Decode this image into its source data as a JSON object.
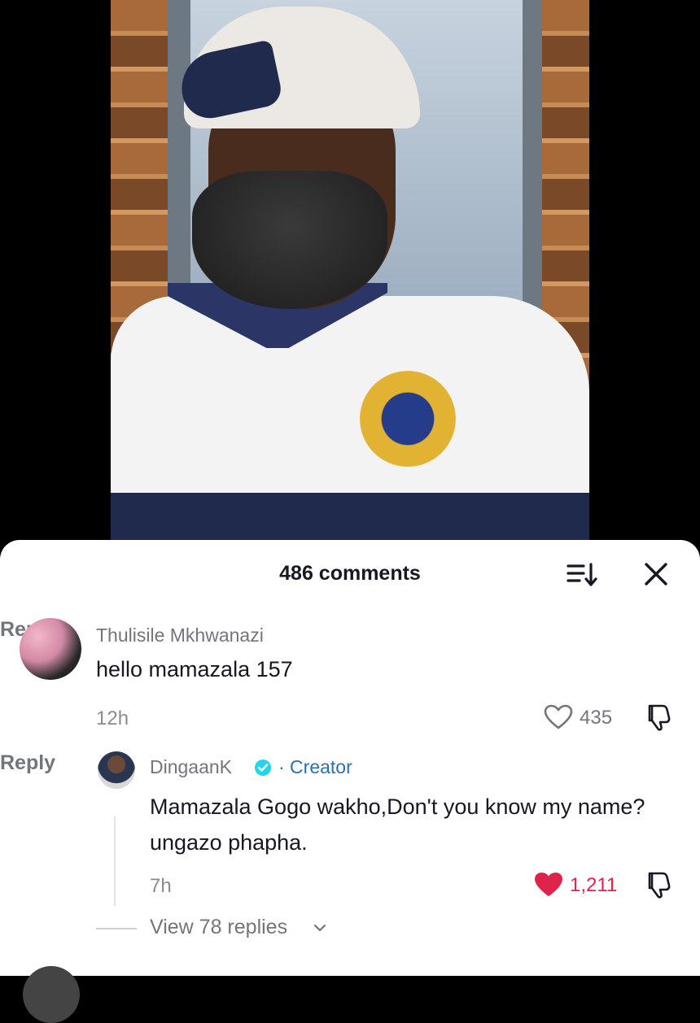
{
  "video": {
    "description_icons": [
      "person-in-cap",
      "stone-wall",
      "window"
    ]
  },
  "comments_sheet": {
    "count_label": "486 comments",
    "sort_icon": "sort-icon",
    "close_icon": "close-icon"
  },
  "comment": {
    "username": "Thulisile Mkhwanazi",
    "text": "hello mamazala 157",
    "time": "12h",
    "reply_label": "Reply",
    "likes": "435"
  },
  "reply": {
    "username": "DingaanK",
    "badge": "· Creator",
    "text": "Mamazala Gogo wakho,Don't you know my name? ungazo phapha.",
    "time": "7h",
    "reply_label": "Reply",
    "likes": "1,211",
    "liked": true
  },
  "view_replies": {
    "label": "View 78 replies"
  },
  "colors": {
    "liked": "#e0234a",
    "creator": "#2a6fb5",
    "verified": "#20d5ec"
  }
}
